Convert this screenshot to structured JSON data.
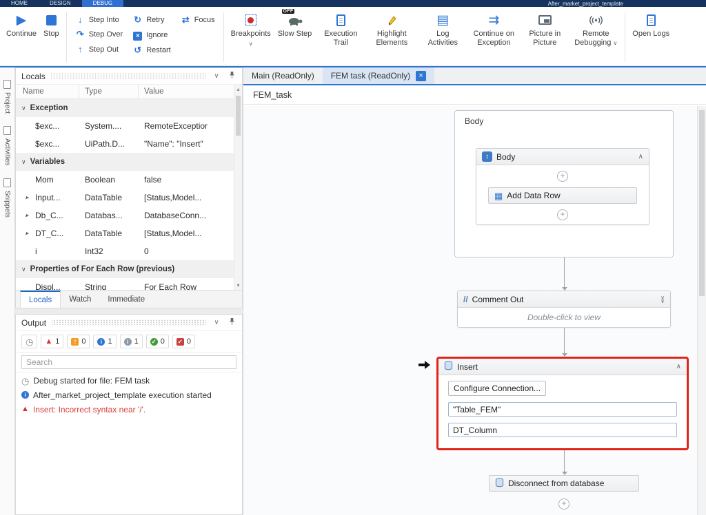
{
  "icons": {
    "play": "▶",
    "step_into": "↓",
    "step_over": "↷",
    "step_out": "↑",
    "retry": "↻",
    "ignore_x": "×",
    "restart": "↺",
    "focus": "⇄",
    "caret_down": "∨",
    "chevron_up": "∧",
    "chevron_down": "∨",
    "list": "▤",
    "list_arrow": "⇉",
    "grid": "▦",
    "plus": "+",
    "close": "×",
    "expander": "▸",
    "clock": "◷",
    "error_triangle": "▲",
    "warn_mark": "!",
    "info_mark": "i",
    "check_mark": "✓",
    "comment_slashes": "//",
    "updown": "↕",
    "scroll_up": "▴",
    "scroll_down": "▾"
  },
  "titlebar": {
    "tabs": [
      {
        "label": "HOME"
      },
      {
        "label": "DESIGN"
      },
      {
        "label": "DEBUG"
      }
    ],
    "project_name": "After_market_project_template"
  },
  "ribbon": {
    "continue_label": "Continue",
    "stop_label": "Stop",
    "step_into": "Step Into",
    "step_over": "Step Over",
    "step_out": "Step Out",
    "retry": "Retry",
    "ignore": "Ignore",
    "restart": "Restart",
    "focus": "Focus",
    "breakpoints": "Breakpoints",
    "slow_step": "Slow Step",
    "slow_step_badge": "OFF",
    "execution_trail": "Execution Trail",
    "highlight_elements": "Highlight Elements",
    "log_activities": "Log Activities",
    "continue_on_exception": "Continue on Exception",
    "picture_in_picture": "Picture in Picture",
    "remote_debugging": "Remote Debugging",
    "open_logs": "Open Logs"
  },
  "left_rail": {
    "items": [
      {
        "label": "Project"
      },
      {
        "label": "Activities"
      },
      {
        "label": "Snippets"
      }
    ]
  },
  "locals_panel": {
    "title": "Locals",
    "columns": [
      "Name",
      "Type",
      "Value"
    ],
    "groups": [
      {
        "label": "Exception",
        "rows": [
          {
            "name": "$exc...",
            "type": "System....",
            "value": "RemoteExceptior"
          },
          {
            "name": "$exc...",
            "type": "UiPath.D...",
            "value": "\"Name\": \"Insert\""
          }
        ]
      },
      {
        "label": "Variables",
        "rows": [
          {
            "name": "Mom",
            "type": "Boolean",
            "value": "false"
          },
          {
            "name": "Input...",
            "type": "DataTable",
            "value": "[Status,Model..."
          },
          {
            "name": "Db_C...",
            "type": "Databas...",
            "value": "DatabaseConn..."
          },
          {
            "name": "DT_C...",
            "type": "DataTable",
            "value": "[Status,Model..."
          },
          {
            "name": "i",
            "type": "Int32",
            "value": "0"
          }
        ]
      },
      {
        "label": "Properties of For Each Row (previous)",
        "rows": [
          {
            "name": "Displ...",
            "type": "String",
            "value": "For Each Row"
          }
        ]
      }
    ],
    "tabs": [
      {
        "label": "Locals"
      },
      {
        "label": "Watch"
      },
      {
        "label": "Immediate"
      }
    ]
  },
  "output_panel": {
    "title": "Output",
    "filters": {
      "error_count": "1",
      "warn_count": "0",
      "info_count": "1",
      "trace_count": "1",
      "success_count": "0",
      "debug_count": "0"
    },
    "search_placeholder": "Search",
    "logs": [
      {
        "text": "Debug started for file: FEM task"
      },
      {
        "text": "After_market_project_template execution started"
      },
      {
        "text": "Insert: Incorrect syntax near '/'."
      }
    ]
  },
  "editor": {
    "tabs": [
      {
        "label": "Main (ReadOnly)"
      },
      {
        "label": "FEM task (ReadOnly)"
      }
    ],
    "breadcrumb": "FEM_task"
  },
  "canvas": {
    "container_label": "Body",
    "sequence_title": "Body",
    "add_data_row_title": "Add Data Row",
    "comment_title": "Comment Out",
    "comment_placeholder": "Double-click to view",
    "insert_title": "Insert",
    "configure_connection": "Configure Connection...",
    "table_value": "\"Table_FEM\"",
    "column_value": "DT_Column",
    "disconnect_title": "Disconnect from database"
  }
}
